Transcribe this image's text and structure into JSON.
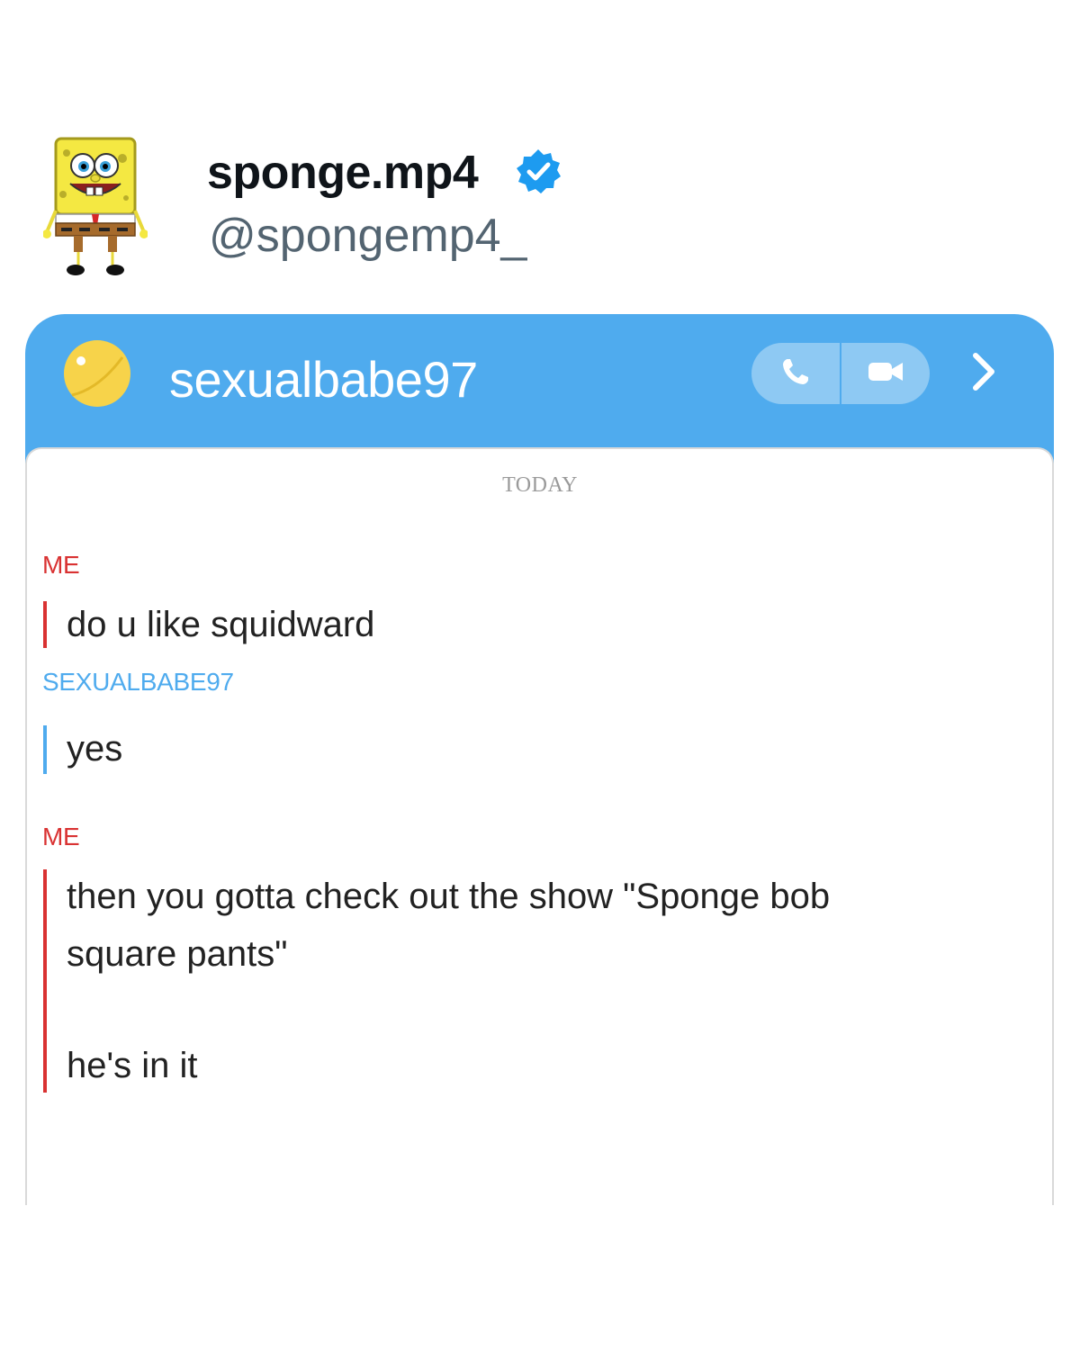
{
  "profile": {
    "display_name": "sponge.mp4",
    "handle": "@spongemp4_",
    "verified_icon": "verified-badge-icon",
    "avatar_icon": "spongebob-avatar-icon"
  },
  "chat": {
    "contact_name": "sexualbabe97",
    "call_icon": "phone-icon",
    "video_icon": "video-camera-icon",
    "more_icon": "chevron-right-icon",
    "date_separator": "TODAY",
    "messages": [
      {
        "sender": "ME",
        "side": "me",
        "lines": [
          "do u like squidward"
        ]
      },
      {
        "sender": "SEXUALBABE97",
        "side": "them",
        "lines": [
          "yes"
        ]
      },
      {
        "sender": "ME",
        "side": "me",
        "lines": [
          "then you gotta check out the show \"Sponge bob",
          "square pants\"",
          "",
          "he's in it"
        ]
      }
    ]
  },
  "colors": {
    "header_blue": "#4fabee",
    "me_red": "#d93232",
    "them_blue": "#4fabee",
    "avatar_yellow": "#f7d34a"
  }
}
